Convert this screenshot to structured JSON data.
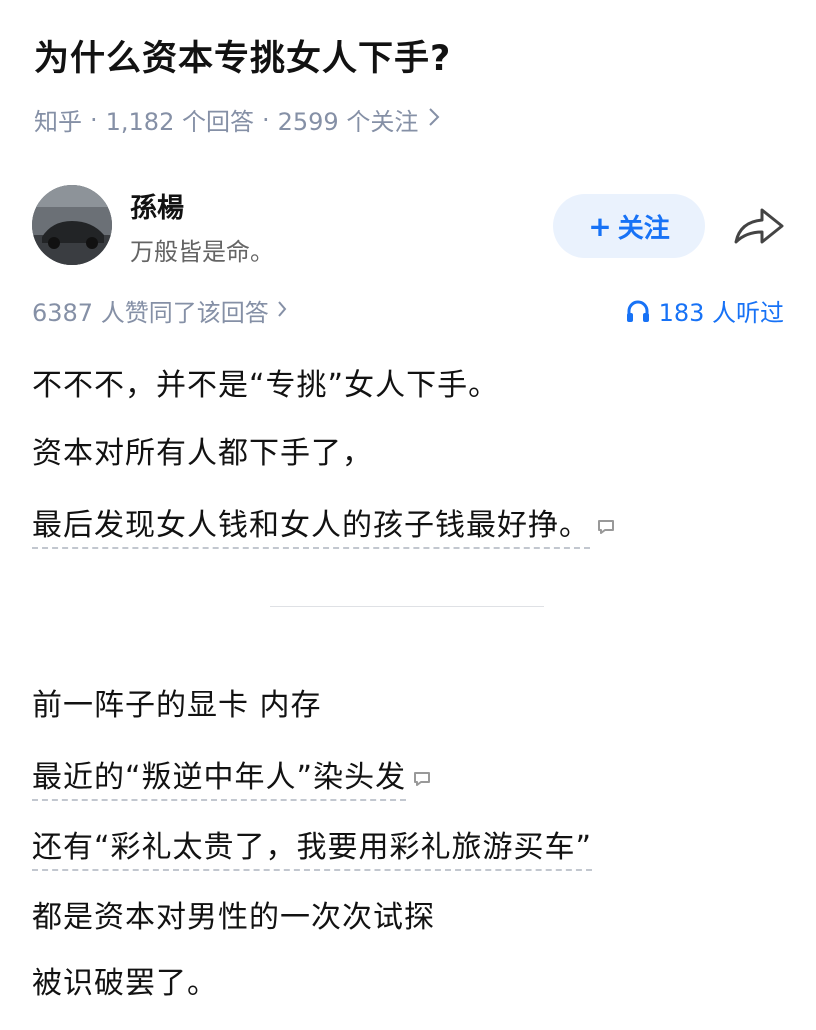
{
  "question": {
    "title": "为什么资本专挑女人下手?",
    "source": "知乎",
    "answers": "1,182 个回答",
    "followers": "2599 个关注",
    "dot": "·"
  },
  "author": {
    "name": "孫楊",
    "bio": "万般皆是命。",
    "follow_label": "关注",
    "follow_plus": "+"
  },
  "stats": {
    "votes": "6387 人赞同了该回答",
    "listens": "183 人听过"
  },
  "content": {
    "p1": "不不不，并不是“专挑”女人下手。",
    "p2": "资本对所有人都下手了，",
    "p3": "最后发现女人钱和女人的孩子钱最好挣。",
    "p4": "前一阵子的显卡 内存",
    "p5": "最近的“叛逆中年人”染头发",
    "p6": "还有“彩礼太贵了，我要用彩礼旅游买车”",
    "p7": "都是资本对男性的一次次试探",
    "p8": "被识破罢了。"
  },
  "icons": {
    "share": "share-icon",
    "headphones": "headphones-icon",
    "comment": "comment-icon",
    "chevron": "chevron-right-icon"
  },
  "colors": {
    "accent": "#1772f6",
    "follow_bg": "#eaf2fd",
    "meta": "#8590a6"
  }
}
